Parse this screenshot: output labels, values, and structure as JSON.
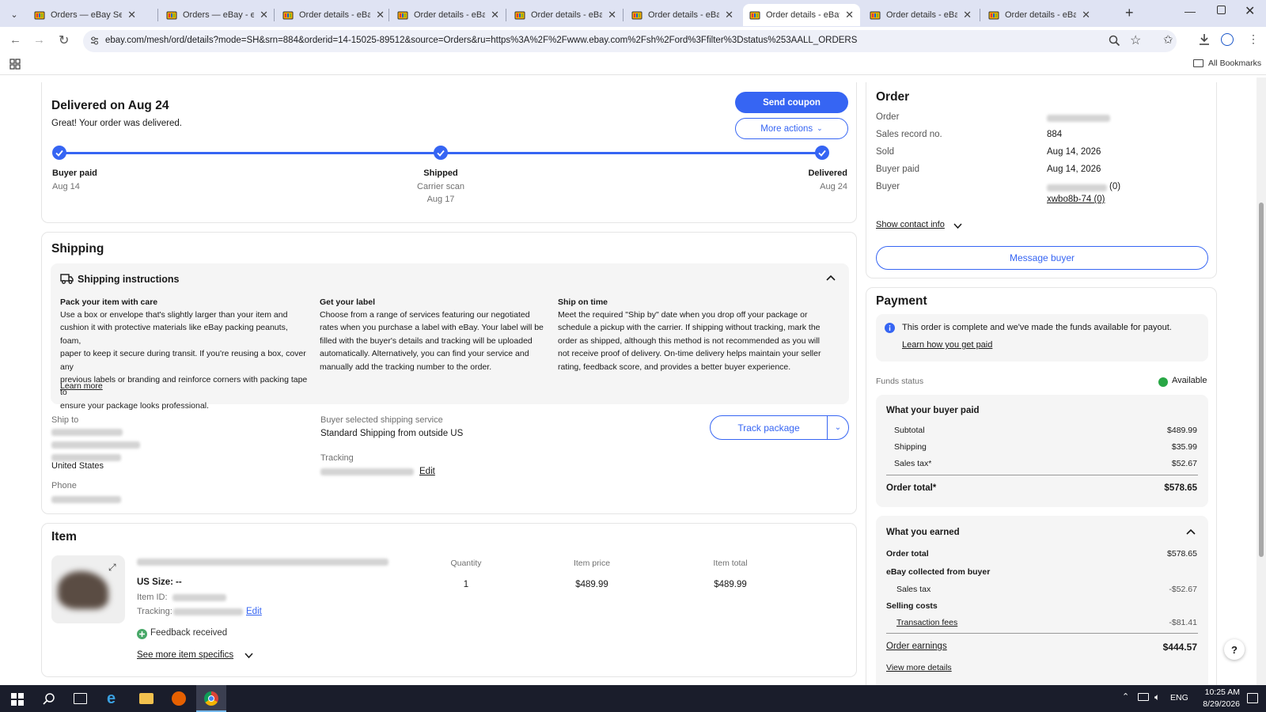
{
  "browser": {
    "tabs": [
      {
        "title": "Orders — eBay Seller Hub"
      },
      {
        "title": "Orders — eBay - eBay"
      },
      {
        "title": "Order details - eBay Se"
      },
      {
        "title": "Order details - eBay Se"
      },
      {
        "title": "Order details - eBay Se"
      },
      {
        "title": "Order details - eBay Se"
      },
      {
        "title": "Order details - eBay Se"
      },
      {
        "title": "Order details - eBay Se"
      },
      {
        "title": "Order details - eBay Se"
      }
    ],
    "active_tab": 6,
    "url": "ebay.com/mesh/ord/details?mode=SH&srn=884&orderid=14-15025-89512&source=Orders&ru=https%3A%2F%2Fwww.ebay.com%2Fsh%2Ford%3Ffilter%3Dstatus%253AALL_ORDERS",
    "all_bookmarks": "All Bookmarks"
  },
  "status": {
    "title": "Delivered on Aug 24",
    "subtitle": "Great! Your order was delivered.",
    "send_coupon": "Send coupon",
    "more_actions": "More actions",
    "steps": [
      {
        "label": "Buyer paid",
        "detail": "Aug 14",
        "detail2": ""
      },
      {
        "label": "Shipped",
        "detail": "Carrier scan",
        "detail2": "Aug 17"
      },
      {
        "label": "Delivered",
        "detail": "Aug 24",
        "detail2": ""
      }
    ]
  },
  "shipping": {
    "title": "Shipping",
    "instructions_title": "Shipping instructions",
    "columns": [
      {
        "heading": "Pack your item with care",
        "lines": [
          "Use a box or envelope that's slightly larger than your item and",
          "cushion it with protective materials like eBay packing peanuts, foam,",
          "paper to keep it secure during transit. If you're reusing a box, cover any",
          "previous labels or branding and reinforce corners with packing tape to",
          "ensure your package looks professional."
        ]
      },
      {
        "heading": "Get your label",
        "lines": [
          "Choose from a range of services featuring our negotiated",
          "rates when you purchase a label with eBay. Your label will be",
          "filled with the buyer's details and tracking will be uploaded",
          "automatically. Alternatively, you can find your service and",
          "manually add the tracking number to the order."
        ]
      },
      {
        "heading": "Ship on time",
        "lines": [
          "Meet the required \"Ship by\" date when you drop off your package or",
          "schedule a pickup with the carrier. If shipping without tracking, mark the",
          "order as shipped, although this method is not recommended as you will",
          "not receive proof of delivery. On-time delivery helps maintain your seller",
          "rating, feedback score, and provides a better buyer experience."
        ]
      }
    ],
    "learn_more": "Learn more",
    "ship_to_label": "Ship to",
    "country": "United States",
    "phone_label": "Phone",
    "service_label": "Buyer selected shipping service",
    "service_value": "Standard Shipping from outside US",
    "tracking_label": "Tracking",
    "edit": "Edit",
    "track_package": "Track package"
  },
  "item": {
    "title": "Item",
    "size_label": "US Size:",
    "size_value": "--",
    "item_id_label": "Item ID:",
    "tracking_label": "Tracking:",
    "edit": "Edit",
    "quantity_label": "Quantity",
    "quantity": "1",
    "price_label": "Item price",
    "price": "$489.99",
    "total_label": "Item total",
    "total": "$489.99",
    "feedback": "Feedback received",
    "see_more": "See more item specifics"
  },
  "order": {
    "title": "Order",
    "rows": [
      {
        "label": "Order",
        "value": ""
      },
      {
        "label": "Sales record no.",
        "value": "884"
      },
      {
        "label": "Sold",
        "value": "Aug 14, 2026"
      },
      {
        "label": "Buyer paid",
        "value": "Aug 14, 2026"
      },
      {
        "label": "Buyer",
        "value": "(0)"
      }
    ],
    "buyer_id": "xwbo8b-74 (0)",
    "show_contact": "Show contact info",
    "message_buyer": "Message buyer"
  },
  "payment": {
    "title": "Payment",
    "notice": "This order is complete and we've made the funds available for payout.",
    "notice_link": "Learn how you get paid",
    "funds_label": "Funds status",
    "funds_value": "Available",
    "buyer_paid_title": "What your buyer paid",
    "buyer_rows": [
      {
        "label": "Subtotal",
        "value": "$489.99"
      },
      {
        "label": "Shipping",
        "value": "$35.99"
      },
      {
        "label": "Sales tax*",
        "value": "$52.67"
      }
    ],
    "order_total_label": "Order total*",
    "order_total": "$578.65",
    "earned_title": "What you earned",
    "earned_order_total_label": "Order total",
    "earned_order_total": "$578.65",
    "collected_label": "eBay collected from buyer",
    "sales_tax_label": "Sales tax",
    "sales_tax_value": "-$52.67",
    "selling_costs_label": "Selling costs",
    "fees_label": "Transaction fees",
    "fees_value": "-$81.41",
    "earnings_label": "Order earnings",
    "earnings_value": "$444.57",
    "view_more": "View more details"
  },
  "taskbar": {
    "lang": "ENG",
    "time": "10:25 AM",
    "date": "8/29/2026"
  },
  "colors": {
    "accent": "#3665f3",
    "progress": "#3665f3",
    "available": "#05823f",
    "tab_bar": "#dfe3f3"
  }
}
